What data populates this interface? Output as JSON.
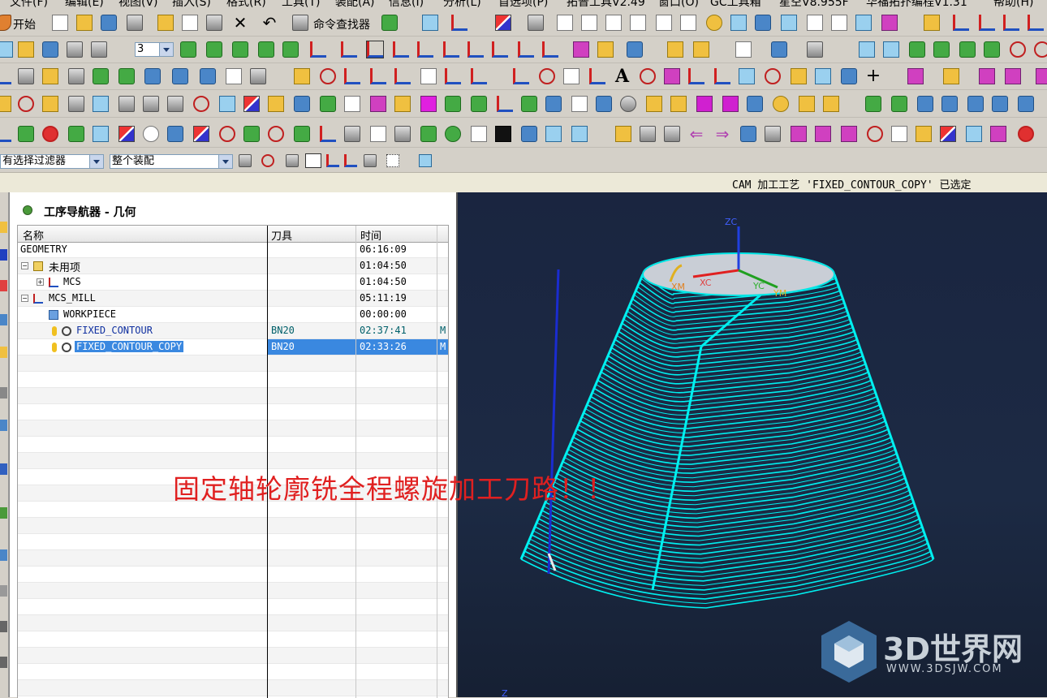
{
  "menu": [
    "文件(F)",
    "编辑(E)",
    "视图(V)",
    "插入(S)",
    "格式(R)",
    "工具(T)",
    "装配(A)",
    "信息(I)",
    "分析(L)",
    "首选项(P)",
    "拓普工具V2.49",
    "窗口(O)",
    "GC工具箱",
    "星空V8.955F",
    "华福拓扑编程V1.31",
    "帮助(H)"
  ],
  "toolbar": {
    "start_label": "开始",
    "command_finder_label": "命令查找器",
    "layer_value": "3",
    "text_tool_label": "A"
  },
  "filterbar": {
    "selection_filter": "有选择过滤器",
    "assembly_scope": "整个装配"
  },
  "status": {
    "message": "CAM 加工工艺 'FIXED_CONTOUR_COPY' 已选定"
  },
  "navigator": {
    "title": "工序导航器 - 几何",
    "columns": {
      "name": "名称",
      "tool": "刀具",
      "time": "时间"
    },
    "rows": [
      {
        "name": "GEOMETRY",
        "tool": "",
        "time": "06:16:09",
        "extra": ""
      },
      {
        "name": "未用项",
        "tool": "",
        "time": "01:04:50",
        "extra": ""
      },
      {
        "name": "MCS",
        "tool": "",
        "time": "01:04:50",
        "extra": ""
      },
      {
        "name": "MCS_MILL",
        "tool": "",
        "time": "05:11:19",
        "extra": ""
      },
      {
        "name": "WORKPIECE",
        "tool": "",
        "time": "00:00:00",
        "extra": ""
      },
      {
        "name": "FIXED_CONTOUR",
        "tool": "BN20",
        "time": "02:37:41",
        "extra": "M"
      },
      {
        "name": "FIXED_CONTOUR_COPY",
        "tool": "BN20",
        "time": "02:33:26",
        "extra": "M"
      }
    ]
  },
  "viewport": {
    "axes": {
      "zc": "ZC",
      "xc": "XC",
      "yc": "YC",
      "xm": "XM",
      "ym": "YM",
      "z": "Z"
    },
    "toolpath_color": "#00f0f0",
    "background": "#1a2540"
  },
  "annotation": "固定轴轮廓铣全程螺旋加工刀路！！",
  "watermark": {
    "brand": "3D世界网",
    "url": "WWW.3DSJW.COM"
  }
}
